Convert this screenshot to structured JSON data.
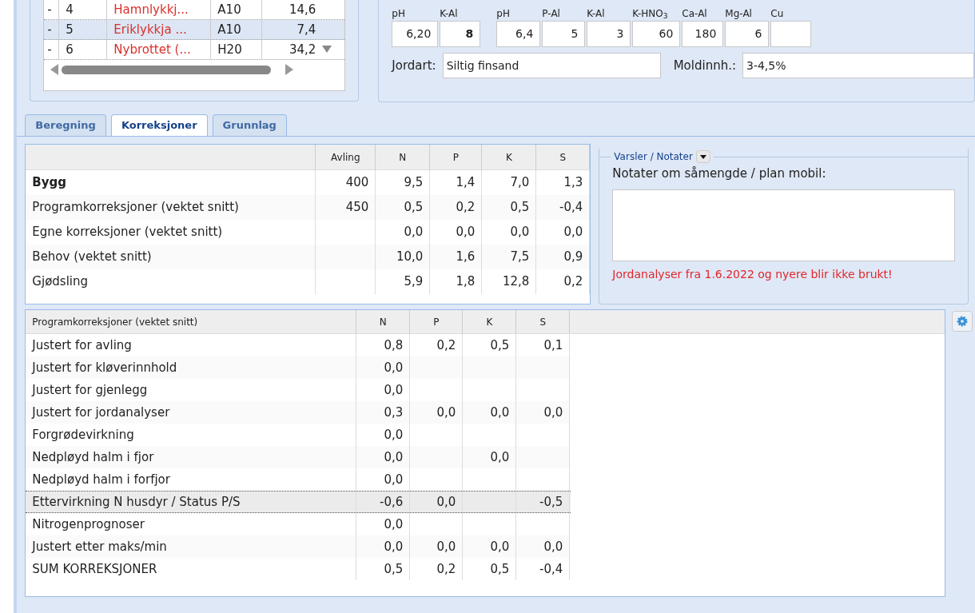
{
  "field_grid": {
    "rows": [
      {
        "marker": "-",
        "number": "4",
        "name": "Hamnlykkj...",
        "code": "A10",
        "area": "14,6",
        "selected": false
      },
      {
        "marker": "-",
        "number": "5",
        "name": "Eriklykkja ...",
        "code": "A10",
        "area": "7,4",
        "selected": true
      },
      {
        "marker": "-",
        "number": "6",
        "name": "Nybrottet (...",
        "code": "H20",
        "area": "34,2",
        "selected": false
      }
    ]
  },
  "soil_analysis": {
    "fields": [
      {
        "label": "pH",
        "value": "6,20",
        "bold": false
      },
      {
        "label": "K-Al",
        "value": "8",
        "bold": true
      },
      {
        "label": "pH",
        "value": "6,4",
        "bold": false
      },
      {
        "label": "P-Al",
        "value": "5",
        "bold": false
      },
      {
        "label": "K-Al",
        "value": "3",
        "bold": false
      },
      {
        "label": "K-HNO$_{3}$",
        "value": "60",
        "bold": false
      },
      {
        "label": "Ca-Al",
        "value": "180",
        "bold": false
      },
      {
        "label": "Mg-Al",
        "value": "6",
        "bold": false
      },
      {
        "label": "Cu"
      }
    ],
    "soil_type": {
      "label": "Jordart:",
      "value": "Siltig finsand"
    },
    "humus": {
      "label": "Moldinnh.:",
      "value": "3-4,5%"
    }
  },
  "tabs": [
    {
      "label": "Beregning",
      "selected": false
    },
    {
      "label": "Korreksjoner",
      "selected": true
    },
    {
      "label": "Grunnlag",
      "selected": false
    }
  ],
  "summary_table": {
    "columns": [
      "Avling",
      "N",
      "P",
      "K",
      "S"
    ],
    "rows": [
      {
        "label": "Bygg",
        "bold": true,
        "cells": [
          "400",
          "9,5",
          "1,4",
          "7,0",
          "1,3"
        ]
      },
      {
        "label": "Programkorreksjoner (vektet snitt)",
        "bold": false,
        "cells": [
          "450",
          "0,5",
          "0,2",
          "0,5",
          "-0,4"
        ]
      },
      {
        "label": "Egne korreksjoner (vektet snitt)",
        "bold": false,
        "cells": [
          "",
          "0,0",
          "0,0",
          "0,0",
          "0,0"
        ]
      },
      {
        "label": "Behov (vektet snitt)",
        "bold": false,
        "cells": [
          "",
          "10,0",
          "1,6",
          "7,5",
          "0,9"
        ]
      },
      {
        "label": "Gjødsling",
        "bold": false,
        "cells": [
          "",
          "5,9",
          "1,8",
          "12,8",
          "0,2"
        ]
      }
    ]
  },
  "notes": {
    "legend": "Varsler / Notater",
    "label": "Notater om såmengde / plan mobil:",
    "warning": "Jordanalyser fra 1.6.2022 og nyere blir ikke brukt!"
  },
  "corrections_table": {
    "title": "Programkorreksjoner (vektet snitt)",
    "columns": [
      "N",
      "P",
      "K",
      "S"
    ],
    "rows": [
      {
        "label": "Justert for avling",
        "selected": false,
        "cells": [
          "0,8",
          "0,2",
          "0,5",
          "0,1"
        ]
      },
      {
        "label": "Justert for kløverinnhold",
        "selected": false,
        "cells": [
          "0,0",
          "",
          "",
          ""
        ]
      },
      {
        "label": "Justert for gjenlegg",
        "selected": false,
        "cells": [
          "0,0",
          "",
          "",
          ""
        ]
      },
      {
        "label": "Justert for jordanalyser",
        "selected": false,
        "cells": [
          "0,3",
          "0,0",
          "0,0",
          "0,0"
        ]
      },
      {
        "label": "Forgrødevirkning",
        "selected": false,
        "cells": [
          "0,0",
          "",
          "",
          ""
        ]
      },
      {
        "label": "Nedpløyd halm i fjor",
        "selected": false,
        "cells": [
          "0,0",
          "",
          "0,0",
          ""
        ]
      },
      {
        "label": "Nedpløyd halm i forfjor",
        "selected": false,
        "cells": [
          "0,0",
          "",
          "",
          ""
        ]
      },
      {
        "label": "Ettervirkning N husdyr / Status P/S",
        "selected": true,
        "cells": [
          "-0,6",
          "0,0",
          "",
          "-0,5"
        ]
      },
      {
        "label": "Nitrogenprognoser",
        "selected": false,
        "cells": [
          "0,0",
          "",
          "",
          ""
        ]
      },
      {
        "label": "Justert etter maks/min",
        "selected": false,
        "cells": [
          "0,0",
          "0,0",
          "0,0",
          "0,0"
        ]
      },
      {
        "label": "SUM KORREKSJONER",
        "selected": false,
        "cells": [
          "0,5",
          "0,2",
          "0,5",
          "-0,4"
        ]
      }
    ]
  }
}
